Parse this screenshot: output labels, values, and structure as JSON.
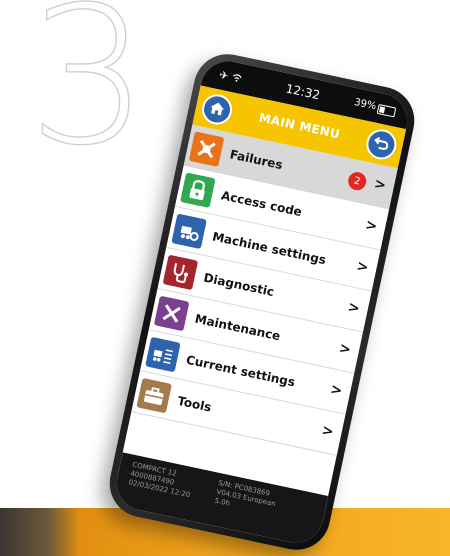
{
  "page": {
    "step_number": "3"
  },
  "status_bar": {
    "time": "12:32",
    "battery_text": "39%",
    "battery_level": 0.39,
    "airplane_icon": "airplane-icon",
    "wifi_icon": "wifi-icon"
  },
  "header": {
    "title": "MAIN MENU",
    "home_icon": "home-icon",
    "back_icon": "back-arrow-icon",
    "background": "#f7c500"
  },
  "menu": {
    "items": [
      {
        "label": "Failures",
        "icon": "wrench-alert-icon",
        "icon_color": "#e8731a",
        "badge": "2",
        "selected": true
      },
      {
        "label": "Access code",
        "icon": "padlock-icon",
        "icon_color": "#2fa84f"
      },
      {
        "label": "Machine settings",
        "icon": "machine-gear-icon",
        "icon_color": "#2f63ad"
      },
      {
        "label": "Diagnostic",
        "icon": "stethoscope-icon",
        "icon_color": "#a4262c"
      },
      {
        "label": "Maintenance",
        "icon": "tools-icon",
        "icon_color": "#7b3f8f"
      },
      {
        "label": "Current settings",
        "icon": "machine-list-icon",
        "icon_color": "#2f63ad"
      },
      {
        "label": "Tools",
        "icon": "toolbox-icon",
        "icon_color": "#a47c4a"
      }
    ],
    "chevron": ">"
  },
  "footer": {
    "model": "COMPACT 12",
    "code": "4000887490",
    "datetime": "02/03/2022 12:20",
    "serial": "S/N: PC083869",
    "version": "V04.03 European",
    "hours": "5.0h"
  }
}
